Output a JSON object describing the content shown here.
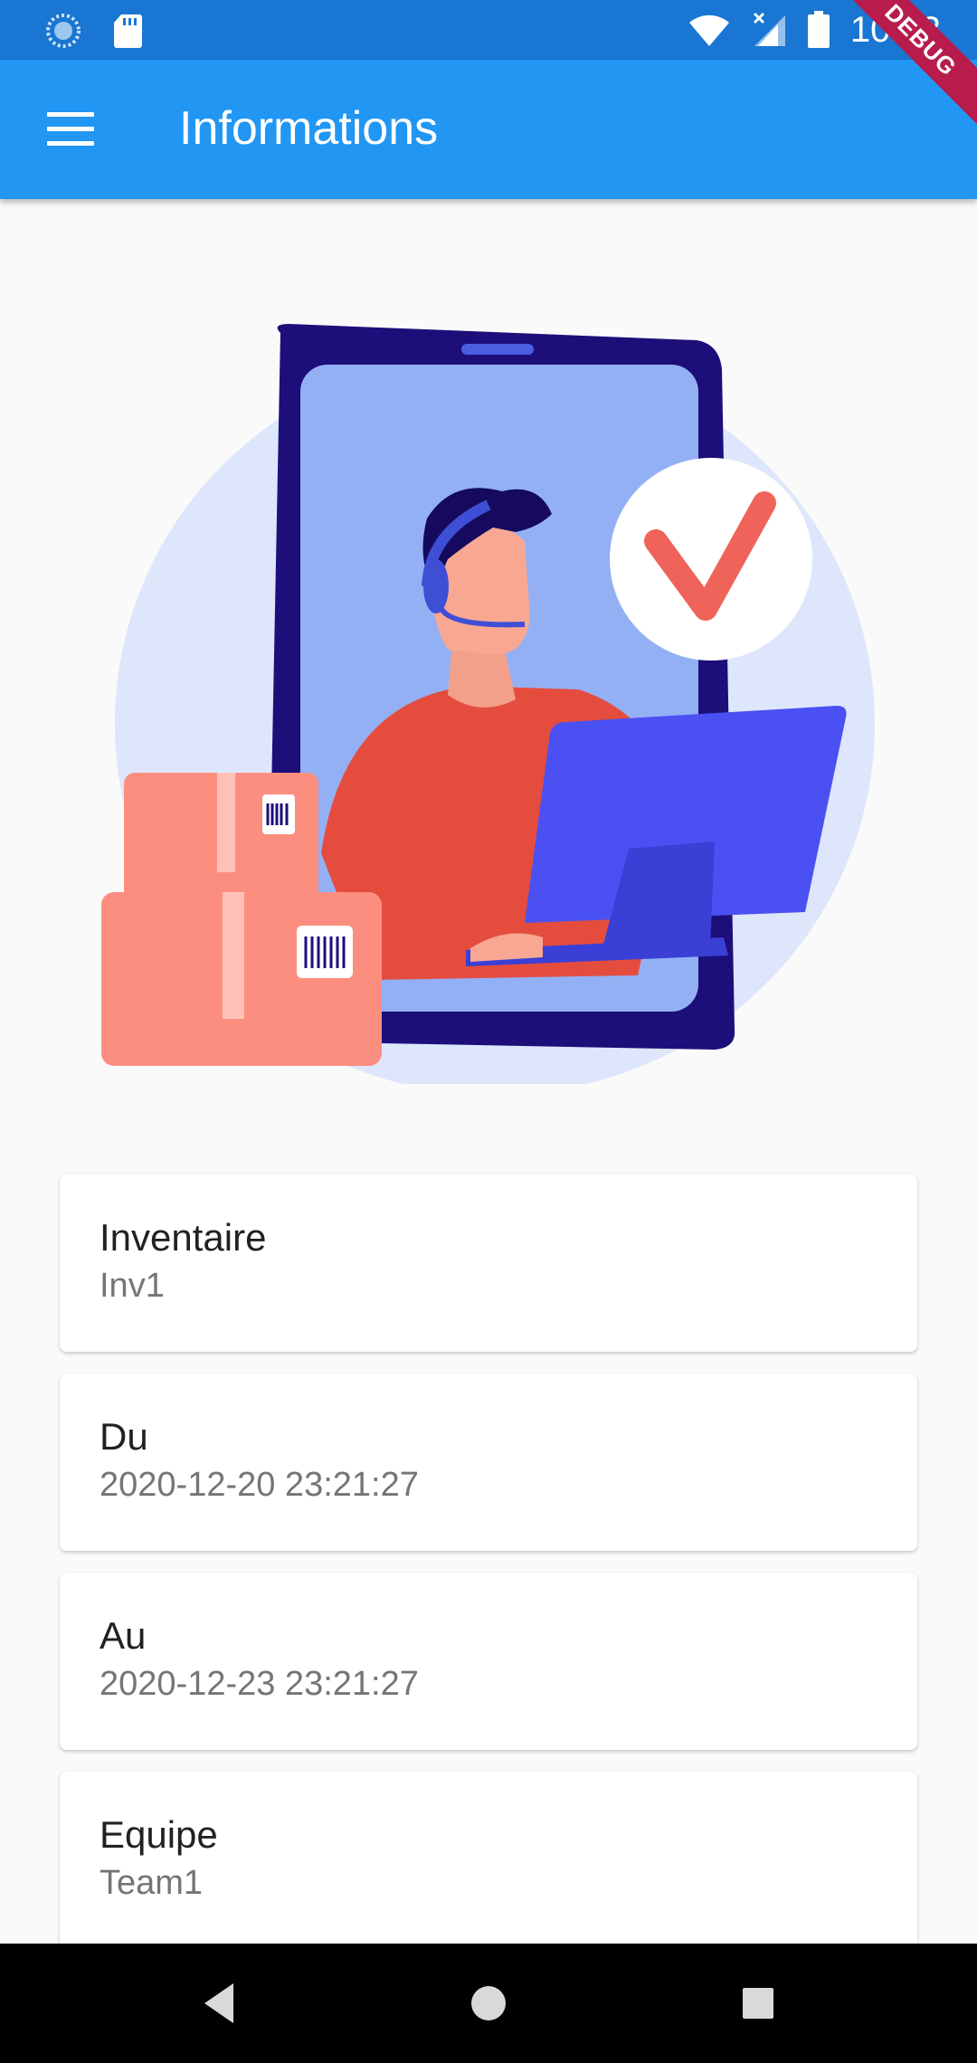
{
  "status_bar": {
    "time": "10:33",
    "icons": [
      "sync-icon",
      "sd-card-icon",
      "wifi-icon",
      "signal-icon",
      "battery-icon"
    ]
  },
  "debug_banner": "DEBUG",
  "app_bar": {
    "title": "Informations",
    "menu_icon": "menu-icon"
  },
  "cards": [
    {
      "label": "Inventaire",
      "value": "Inv1"
    },
    {
      "label": "Du",
      "value": "2020-12-20 23:21:27"
    },
    {
      "label": "Au",
      "value": "2020-12-23 23:21:27"
    },
    {
      "label": "Equipe",
      "value": "Team1"
    }
  ],
  "nav_bar": {
    "icons": [
      "back-icon",
      "home-icon",
      "recents-icon"
    ]
  },
  "colors": {
    "status_bar": "#1976d2",
    "app_bar": "#2196f3",
    "background": "#fafafa"
  }
}
